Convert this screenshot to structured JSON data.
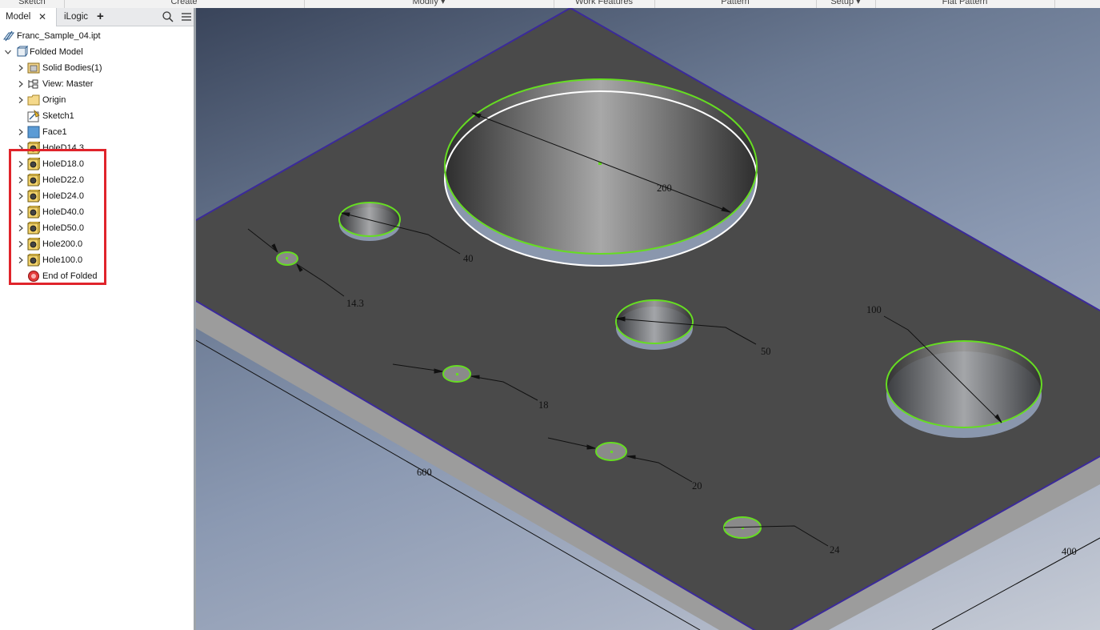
{
  "ribbon": {
    "groups": [
      "Sketch",
      "Create",
      "Modify",
      "Work Features",
      "Pattern",
      "Setup",
      "Flat Pattern"
    ]
  },
  "browser": {
    "tabs": [
      {
        "label": "Model",
        "active": true
      },
      {
        "label": "iLogic",
        "active": false
      }
    ],
    "add_tab": "+",
    "tree": {
      "part": "Franc_Sample_04.ipt",
      "model": "Folded Model",
      "items": [
        {
          "label": "Solid Bodies(1)",
          "icon": "solid-bodies-icon"
        },
        {
          "label": "View: Master",
          "icon": "view-icon"
        },
        {
          "label": "Origin",
          "icon": "folder-icon"
        },
        {
          "label": "Sketch1",
          "icon": "sketch-icon"
        },
        {
          "label": "Face1",
          "icon": "face-icon"
        },
        {
          "label": "HoleD14.3",
          "icon": "hole-icon"
        },
        {
          "label": "HoleD18.0",
          "icon": "hole-icon"
        },
        {
          "label": "HoleD22.0",
          "icon": "hole-icon"
        },
        {
          "label": "HoleD24.0",
          "icon": "hole-icon"
        },
        {
          "label": "HoleD40.0",
          "icon": "hole-icon"
        },
        {
          "label": "HoleD50.0",
          "icon": "hole-icon"
        },
        {
          "label": "Hole200.0",
          "icon": "hole-icon"
        },
        {
          "label": "Hole100.0",
          "icon": "hole-icon"
        },
        {
          "label": "End of Folded",
          "icon": "end-of-part-icon"
        }
      ]
    }
  },
  "viewport": {
    "dimensions": {
      "d200": "200",
      "d40": "40",
      "d14": "14.3",
      "d50": "50",
      "d100": "100",
      "d18": "18",
      "d20": "20",
      "d24": "24",
      "w600": "600",
      "w400": "400"
    },
    "colors": {
      "plate": "#4a4a4a",
      "plate_edge": "#3b2a9a",
      "selection": "#66dd22"
    }
  }
}
